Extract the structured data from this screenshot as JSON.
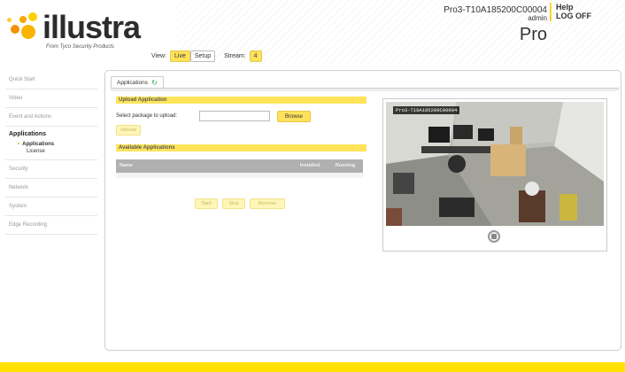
{
  "brand": {
    "logo_text": "illustra",
    "tagline": "From Tyco Security Products"
  },
  "viewbar": {
    "view_label": "View:",
    "live_label": "Live",
    "setup_label": "Setup",
    "stream_label": "Stream:",
    "stream_value": "4"
  },
  "device": {
    "model": "Pro3-T10A185200C00004",
    "user": "admin",
    "edition": "Pro"
  },
  "links": {
    "help": "Help",
    "logoff": "LOG OFF"
  },
  "sidebar": {
    "items": [
      {
        "label": "Quick Start"
      },
      {
        "label": "Video"
      },
      {
        "label": "Event and Actions"
      },
      {
        "label": "Applications"
      },
      {
        "label": "Security"
      },
      {
        "label": "Network"
      },
      {
        "label": "System"
      },
      {
        "label": "Edge Recording"
      }
    ],
    "subitems": [
      {
        "label": "Applications"
      },
      {
        "label": "License"
      }
    ]
  },
  "main": {
    "tab_label": "Applications",
    "upload_section": "Upload Application",
    "select_label": "Select package to upload:",
    "browse_label": "Browse",
    "upload_button": "Upload",
    "available_section": "Available Applications",
    "table": {
      "columns": [
        "Name",
        "Installed",
        "Running"
      ]
    },
    "actions": {
      "start": "Start",
      "stop": "Stop",
      "remove": "Remove"
    }
  },
  "video": {
    "title": "Pro3-T10A185200C00004"
  },
  "colors": {
    "accent": "#ffe100",
    "accent_button": "#ffe15c"
  }
}
